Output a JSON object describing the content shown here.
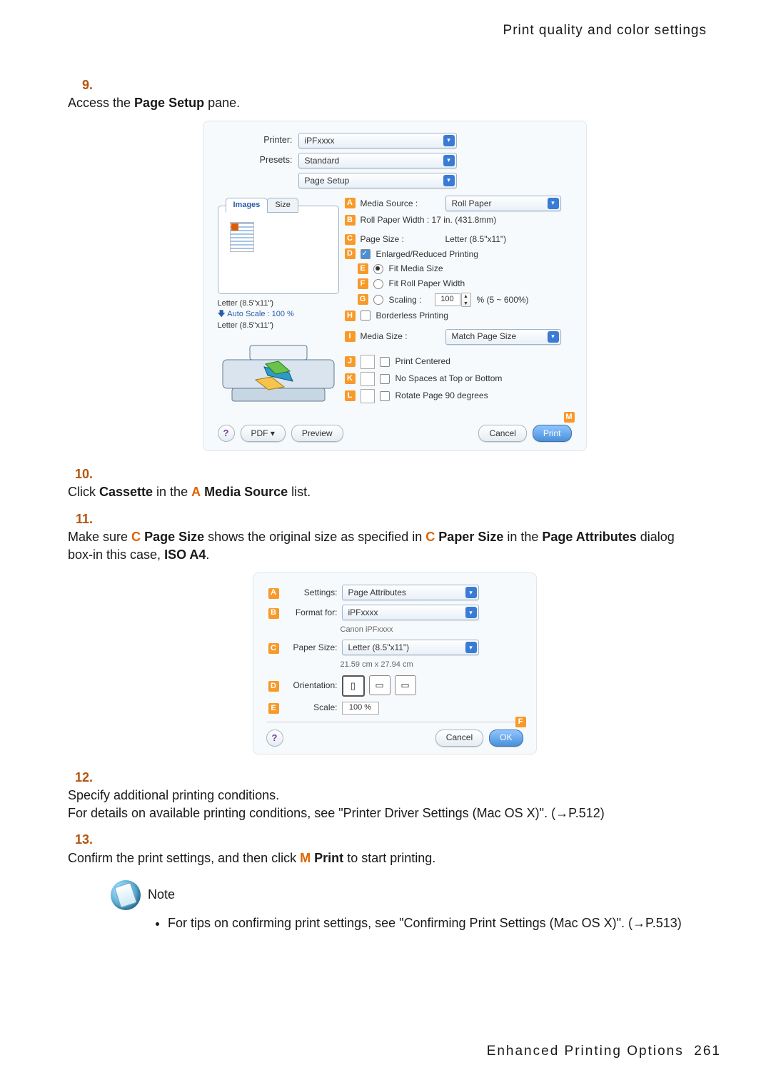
{
  "header": "Print quality and color settings",
  "steps": {
    "s9": {
      "num": "9.",
      "text_a": "Access the ",
      "bold_a": "Page Setup",
      "text_b": " pane."
    },
    "s10": {
      "num": "10.",
      "text_a": "Click ",
      "bold_a": "Cassette",
      "text_b": " in the ",
      "letter_a": "A",
      "bold_b": "Media Source",
      "text_c": " list."
    },
    "s11": {
      "num": "11.",
      "text_a": "Make sure ",
      "letter_a": "C",
      "bold_a": "Page Size",
      "text_b": " shows the original size as specified in ",
      "letter_b": "C",
      "bold_b": "Paper Size",
      "text_c": " in the ",
      "bold_c": "Page Attributes",
      "text_d": " dialog box-in this case, ",
      "bold_d": "ISO A4",
      "text_e": "."
    },
    "s12": {
      "num": "12.",
      "line1": "Specify additional printing conditions.",
      "line2_a": "For details on available printing conditions, see \"Printer Driver Settings (Mac OS X)\".  (",
      "line2_link": "→P.512",
      "line2_b": ")"
    },
    "s13": {
      "num": "13.",
      "text_a": "Confirm the print settings, and then click ",
      "letter_a": "M",
      "bold_a": "Print",
      "text_b": " to start printing."
    }
  },
  "figure1": {
    "printer_label": "Printer:",
    "printer_value": "iPFxxxx",
    "presets_label": "Presets:",
    "presets_value": "Standard",
    "pane_value": "Page Setup",
    "tabs": {
      "images": "Images",
      "size": "Size"
    },
    "info1": "Letter (8.5\"x11\")",
    "info2_prefix": "🡇 Auto Scale : ",
    "info2_val": "100 %",
    "info3": "Letter (8.5\"x11\")",
    "A_label": "Media Source :",
    "A_value": "Roll Paper",
    "B_text": "Roll Paper Width :  17 in. (431.8mm)",
    "C_label": "Page Size :",
    "C_value": "Letter (8.5\"x11\")",
    "D_text": "Enlarged/Reduced Printing",
    "E_text": "Fit Media Size",
    "F_text": "Fit Roll Paper Width",
    "G_label": "Scaling :",
    "G_value": "100",
    "G_suffix": "% (5 ~ 600%)",
    "H_text": "Borderless Printing",
    "I_label": "Media Size :",
    "I_value": "Match Page Size",
    "J_text": "Print Centered",
    "K_text": "No Spaces at Top or Bottom",
    "L_text": "Rotate Page 90 degrees",
    "help": "?",
    "pdf": "PDF ▾",
    "preview": "Preview",
    "cancel": "Cancel",
    "print": "Print"
  },
  "figure2": {
    "A_label": "Settings:",
    "A_value": "Page Attributes",
    "B_label": "Format for:",
    "B_value": "iPFxxxx",
    "B_sub": "Canon iPFxxxx",
    "C_label": "Paper Size:",
    "C_value": "Letter (8.5\"x11\")",
    "C_sub": "21.59 cm x 27.94 cm",
    "D_label": "Orientation:",
    "E_label": "Scale:",
    "E_value": "100 %",
    "help": "?",
    "cancel": "Cancel",
    "ok": "OK"
  },
  "note": {
    "label": "Note",
    "bullet_a": "For tips on confirming print settings, see \"Confirming Print Settings (Mac OS X)\".  (",
    "bullet_link": "→P.513",
    "bullet_b": ")"
  },
  "footer": {
    "text": "Enhanced  Printing  Options",
    "page": "261"
  }
}
